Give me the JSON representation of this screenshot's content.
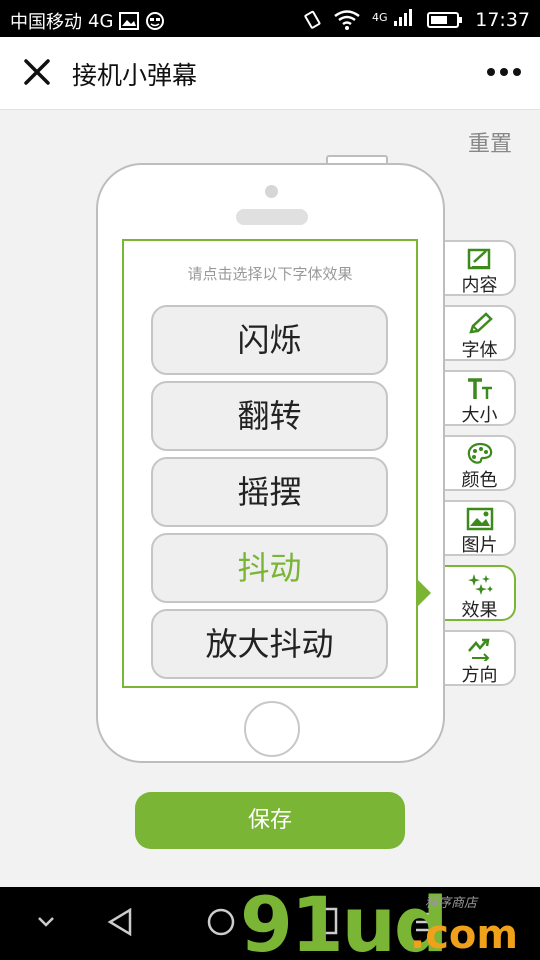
{
  "status_bar": {
    "carrier": "中国移动",
    "network": "4G",
    "signal_label": "4G",
    "time": "17:37"
  },
  "header": {
    "title": "接机小弹幕"
  },
  "toolbar": {
    "reset_label": "重置"
  },
  "screen": {
    "hint": "请点击选择以下字体效果",
    "options": [
      "闪烁",
      "翻转",
      "摇摆",
      "抖动",
      "放大抖动"
    ],
    "selected": "抖动"
  },
  "tabs": [
    {
      "label": "内容",
      "icon": "edit-icon"
    },
    {
      "label": "字体",
      "icon": "pencil-icon"
    },
    {
      "label": "大小",
      "icon": "text-size-icon"
    },
    {
      "label": "颜色",
      "icon": "palette-icon"
    },
    {
      "label": "图片",
      "icon": "image-icon"
    },
    {
      "label": "效果",
      "icon": "sparkle-icon"
    },
    {
      "label": "方向",
      "icon": "direction-icon"
    }
  ],
  "active_tab": "效果",
  "save_label": "保存",
  "watermark": {
    "main": "91ud",
    "suffix": ".com",
    "tagline": "程序商店"
  },
  "colors": {
    "accent": "#7ab536",
    "watermark_orange": "#f0a11c"
  }
}
